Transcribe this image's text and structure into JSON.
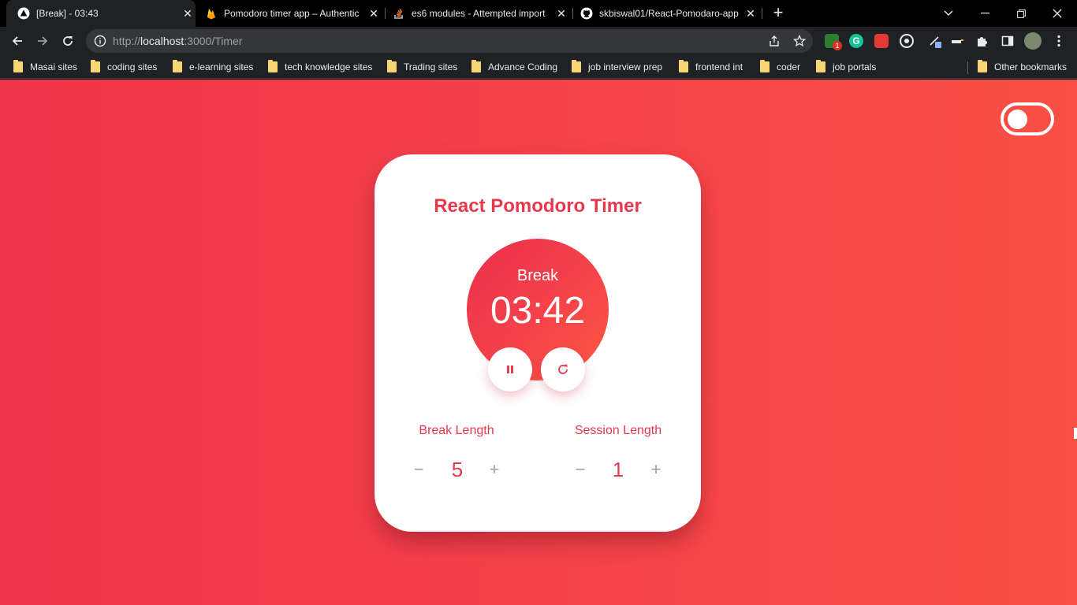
{
  "browser": {
    "tabs": [
      {
        "title": "[Break] - 03:43",
        "icon": "react-app-icon",
        "active": true
      },
      {
        "title": "Pomodoro timer app – Authentic",
        "icon": "firebase-icon",
        "active": false
      },
      {
        "title": "es6 modules - Attempted import",
        "icon": "stackoverflow-icon",
        "active": false
      },
      {
        "title": "skbiswal01/React-Pomodaro-app",
        "icon": "github-icon",
        "active": false
      }
    ],
    "new_tab_label": "+",
    "address": {
      "prefix": "http://",
      "host": "localhost",
      "rest": ":3000/Timer"
    },
    "bookmarks": [
      "Masai sites",
      "coding sites",
      "e-learning sites",
      "tech knowledge sites",
      "Trading sites",
      "Advance Coding",
      "job interview prep",
      "frontend int",
      "coder",
      "job portals"
    ],
    "other_bookmarks": "Other bookmarks",
    "extension_badge": "1"
  },
  "app": {
    "title": "React Pomodoro Timer",
    "mode_label": "Break",
    "time": "03:42",
    "break_length": {
      "label": "Break Length",
      "value": "5",
      "minus": "−",
      "plus": "+"
    },
    "session_length": {
      "label": "Session Length",
      "value": "1",
      "minus": "−",
      "plus": "+"
    },
    "theme_toggle_on": false
  },
  "colors": {
    "accent": "#e8384c",
    "gradient_start": "#f1344a",
    "gradient_end": "#f94f44",
    "card": "#ffffff"
  }
}
